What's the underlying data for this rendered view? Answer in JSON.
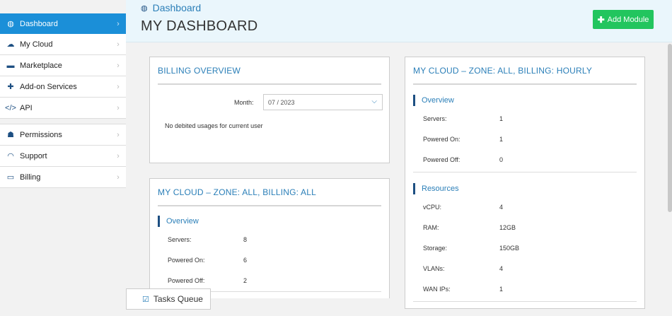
{
  "sidebar": {
    "items": [
      {
        "label": "Dashboard",
        "icon": "dashboard-icon",
        "glyph": "◍"
      },
      {
        "label": "My Cloud",
        "icon": "cloud-icon",
        "glyph": "☁"
      },
      {
        "label": "Marketplace",
        "icon": "cart-icon",
        "glyph": "▬"
      },
      {
        "label": "Add-on Services",
        "icon": "puzzle-icon",
        "glyph": "✚"
      },
      {
        "label": "API",
        "icon": "code-icon",
        "glyph": "</>"
      },
      {
        "label": "Permissions",
        "icon": "users-icon",
        "glyph": "☗"
      },
      {
        "label": "Support",
        "icon": "headset-icon",
        "glyph": "◠"
      },
      {
        "label": "Billing",
        "icon": "credit-card-icon",
        "glyph": "▭"
      }
    ],
    "chevron": "›"
  },
  "header": {
    "breadcrumb": "Dashboard",
    "title": "MY DASHBOARD",
    "add_module_label": "Add Module"
  },
  "billing_overview": {
    "title": "BILLING OVERVIEW",
    "month_label": "Month:",
    "month_value": "07 / 2023",
    "empty_message": "No debited usages for current user"
  },
  "cloud_all": {
    "title": "MY CLOUD – ZONE: ALL, BILLING: ALL",
    "overview_label": "Overview",
    "rows": [
      {
        "label": "Servers:",
        "value": "8"
      },
      {
        "label": "Powered On:",
        "value": "6"
      },
      {
        "label": "Powered Off:",
        "value": "2"
      }
    ]
  },
  "cloud_hourly": {
    "title": "MY CLOUD – ZONE: ALL, BILLING: HOURLY",
    "overview_label": "Overview",
    "overview_rows": [
      {
        "label": "Servers:",
        "value": "1"
      },
      {
        "label": "Powered On:",
        "value": "1"
      },
      {
        "label": "Powered Off:",
        "value": "0"
      }
    ],
    "resources_label": "Resources",
    "resource_rows": [
      {
        "label": "vCPU:",
        "value": "4"
      },
      {
        "label": "RAM:",
        "value": "12GB"
      },
      {
        "label": "Storage:",
        "value": "150GB"
      },
      {
        "label": "VLANs:",
        "value": "4"
      },
      {
        "label": "WAN IPs:",
        "value": "1"
      }
    ]
  },
  "tasks_queue": {
    "label": "Tasks Queue"
  },
  "colors": {
    "accent": "#1b8fd8",
    "link": "#2b7fb8",
    "navy": "#1d4f82",
    "success": "#22c55e"
  }
}
